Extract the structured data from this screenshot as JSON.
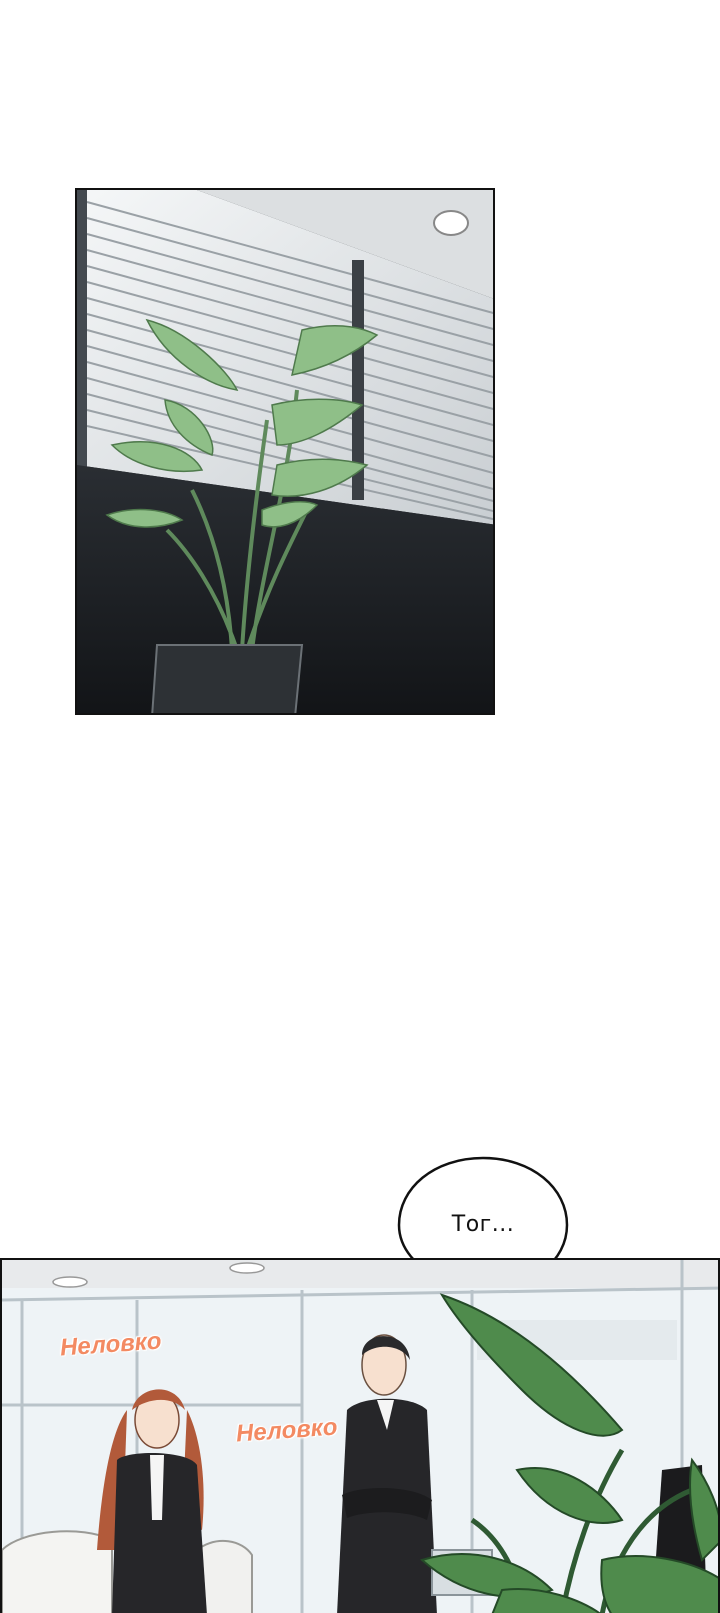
{
  "panels": [
    {
      "scene": "office window with blinds and potted plant"
    },
    {
      "scene": "office interior with two people"
    }
  ],
  "speech_bubble": {
    "text": "Тог..."
  },
  "sound_effects": [
    {
      "text": "Неловко"
    },
    {
      "text": "Неловко"
    }
  ],
  "colors": {
    "sfx": "#f38a62",
    "plant_leaf": "#7fae7a",
    "wall_dark": "#1b1e22",
    "suit": "#262629"
  }
}
